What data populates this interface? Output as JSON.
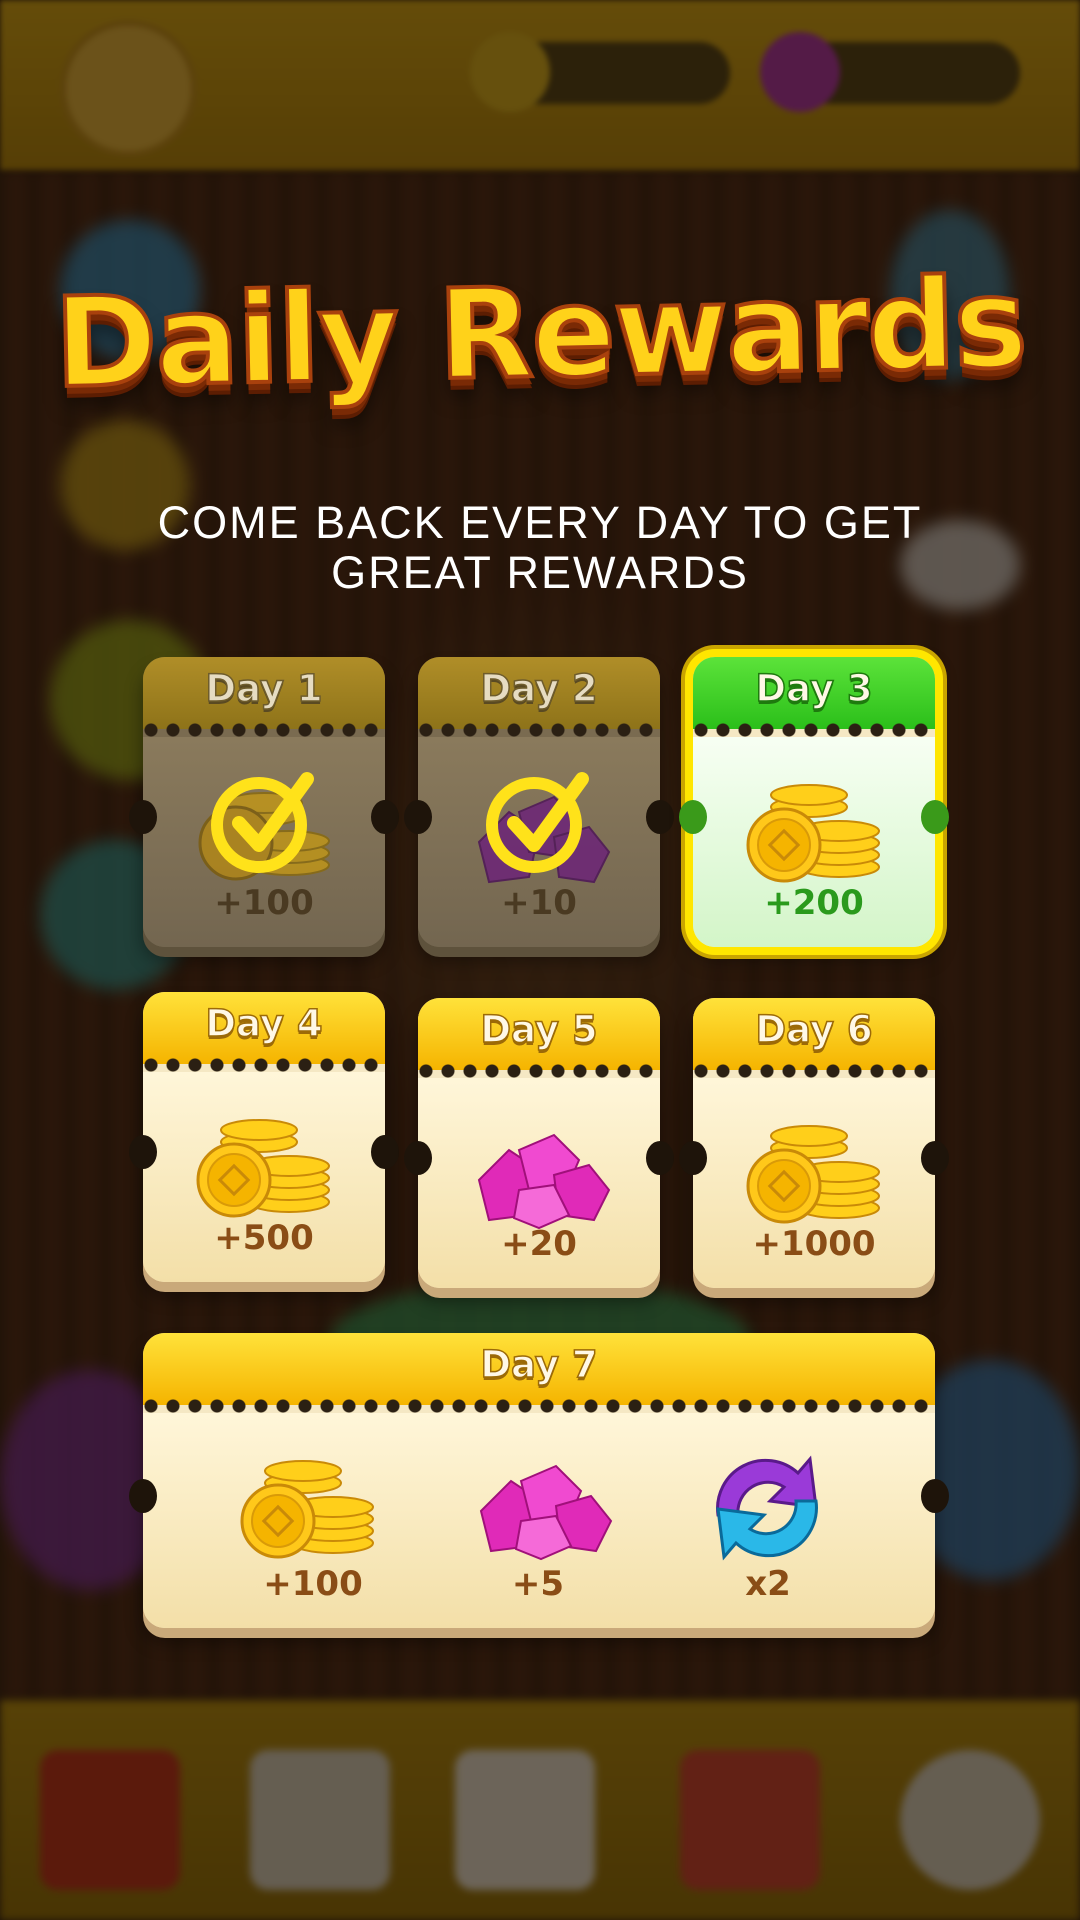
{
  "title": "Daily Rewards",
  "subtitle": "COME BACK EVERY DAY TO GET GREAT REWARDS",
  "colors": {
    "title_fill": "#ffd21a",
    "title_outline": "#a9410d",
    "card_header": "#f5b400",
    "current_header": "#2bbf1a",
    "current_highlight": "#ffe600",
    "claimed_overlay": "#8a7a5c"
  },
  "rewards": [
    {
      "day": "Day 1",
      "amount": "+100",
      "icon": "coin-stack-icon",
      "state": "claimed"
    },
    {
      "day": "Day 2",
      "amount": "+10",
      "icon": "gem-pile-icon",
      "state": "claimed"
    },
    {
      "day": "Day 3",
      "amount": "+200",
      "icon": "coin-stack-icon",
      "state": "current"
    },
    {
      "day": "Day 4",
      "amount": "+500",
      "icon": "coin-stack-icon",
      "state": "locked"
    },
    {
      "day": "Day 5",
      "amount": "+20",
      "icon": "gem-pile-icon",
      "state": "locked"
    },
    {
      "day": "Day 6",
      "amount": "+1000",
      "icon": "coin-stack-icon",
      "state": "locked"
    }
  ],
  "day7": {
    "day": "Day 7",
    "items": [
      {
        "amount": "+100",
        "icon": "coin-stack-icon"
      },
      {
        "amount": "+5",
        "icon": "gem-pile-icon"
      },
      {
        "amount": "x2",
        "icon": "refresh-arrows-icon"
      }
    ]
  }
}
